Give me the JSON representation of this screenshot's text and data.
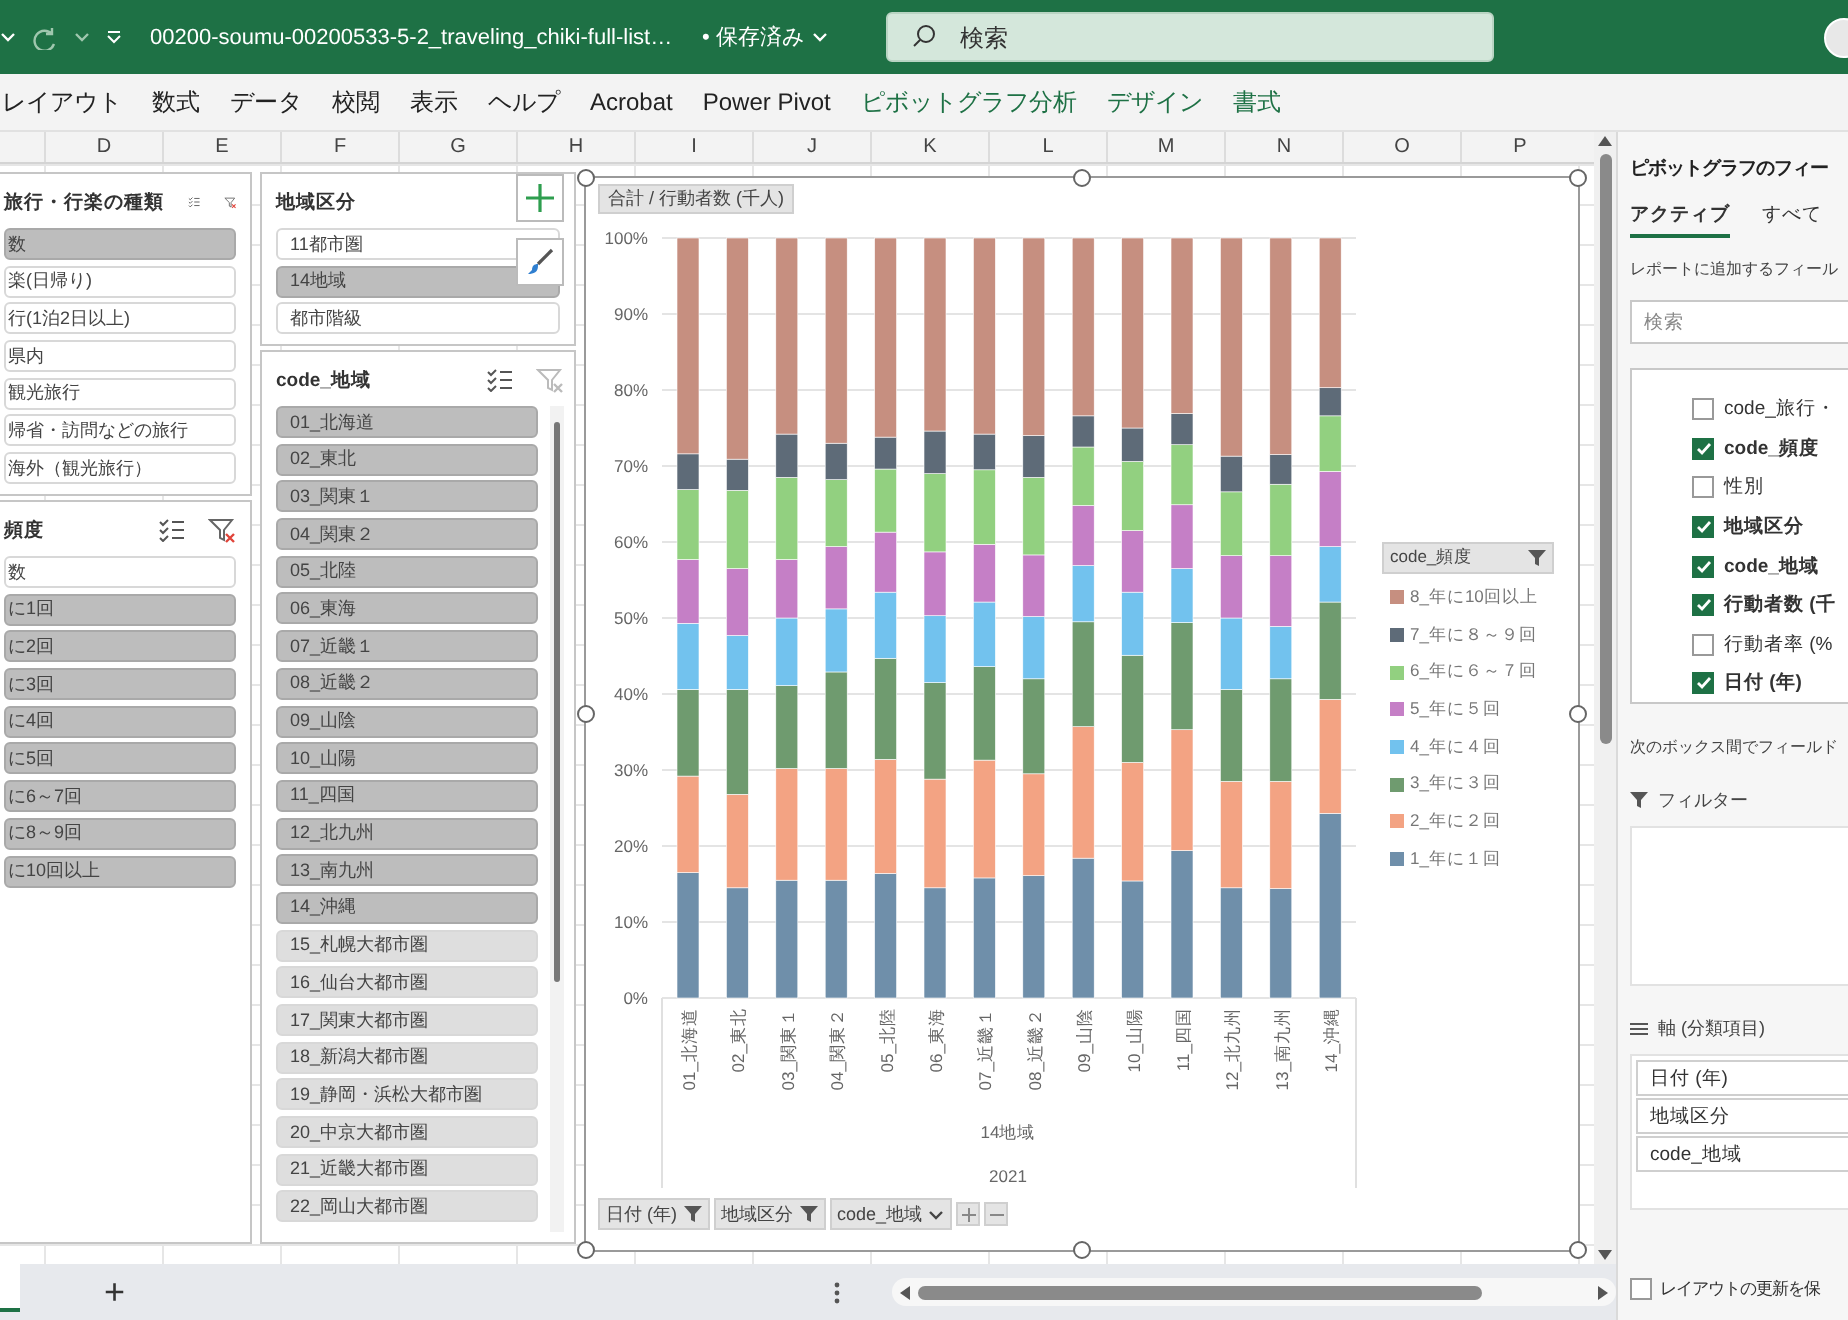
{
  "title_bar": {
    "file_name": "00200-soumu-00200533-5-2_traveling_chiki-full-list…",
    "save_status": "• 保存済み",
    "search": {
      "placeholder": "検索"
    }
  },
  "ribbon_tabs": [
    {
      "label": "レイアウト",
      "kind": "normal"
    },
    {
      "label": "数式",
      "kind": "normal"
    },
    {
      "label": "データ",
      "kind": "normal"
    },
    {
      "label": "校閲",
      "kind": "normal"
    },
    {
      "label": "表示",
      "kind": "normal"
    },
    {
      "label": "ヘルプ",
      "kind": "normal"
    },
    {
      "label": "Acrobat",
      "kind": "normal"
    },
    {
      "label": "Power Pivot",
      "kind": "normal"
    },
    {
      "label": "ピボットグラフ分析",
      "kind": "contextual"
    },
    {
      "label": "デザイン",
      "kind": "contextual"
    },
    {
      "label": "書式",
      "kind": "contextual"
    }
  ],
  "column_headers": [
    "D",
    "E",
    "F",
    "G",
    "H",
    "I",
    "J",
    "K",
    "L",
    "M",
    "N",
    "O",
    "P"
  ],
  "slicers": [
    {
      "title": "旅行・行楽の種類",
      "kind": "plain",
      "filtered": true,
      "items": [
        {
          "label": "数",
          "selected": true
        },
        {
          "label": "楽(日帰り)",
          "selected": false
        },
        {
          "label": "行(1泊2日以上)",
          "selected": false
        },
        {
          "label": "県内",
          "selected": false
        },
        {
          "label": "観光旅行",
          "selected": false
        },
        {
          "label": "帰省・訪問などの旅行",
          "selected": false
        },
        {
          "label": "海外（観光旅行）",
          "selected": false
        }
      ]
    },
    {
      "title": "頻度",
      "kind": "plain",
      "filtered": true,
      "items": [
        {
          "label": "数",
          "selected": false
        },
        {
          "label": "に1回",
          "selected": true
        },
        {
          "label": "に2回",
          "selected": true
        },
        {
          "label": "に3回",
          "selected": true
        },
        {
          "label": "に4回",
          "selected": true
        },
        {
          "label": "に5回",
          "selected": true
        },
        {
          "label": "に6～7回",
          "selected": true
        },
        {
          "label": "に8～9回",
          "selected": true
        },
        {
          "label": "に10回以上",
          "selected": true
        }
      ]
    },
    {
      "title": "地域区分",
      "kind": "plain",
      "items": [
        {
          "label": "11都市圏",
          "selected": false
        },
        {
          "label": "14地域",
          "selected": true
        },
        {
          "label": "都市階級",
          "selected": false
        }
      ]
    },
    {
      "title": "code_地域",
      "kind": "scroll",
      "filtered": false,
      "items": [
        {
          "label": "01_北海道",
          "selected": true
        },
        {
          "label": "02_東北",
          "selected": true
        },
        {
          "label": "03_関東１",
          "selected": true
        },
        {
          "label": "04_関東２",
          "selected": true
        },
        {
          "label": "05_北陸",
          "selected": true
        },
        {
          "label": "06_東海",
          "selected": true
        },
        {
          "label": "07_近畿１",
          "selected": true
        },
        {
          "label": "08_近畿２",
          "selected": true
        },
        {
          "label": "09_山陰",
          "selected": true
        },
        {
          "label": "10_山陽",
          "selected": true
        },
        {
          "label": "11_四国",
          "selected": true
        },
        {
          "label": "12_北九州",
          "selected": true
        },
        {
          "label": "13_南九州",
          "selected": true
        },
        {
          "label": "14_沖縄",
          "selected": true
        },
        {
          "label": "15_札幌大都市圏",
          "selected": false
        },
        {
          "label": "16_仙台大都市圏",
          "selected": false
        },
        {
          "label": "17_関東大都市圏",
          "selected": false
        },
        {
          "label": "18_新潟大都市圏",
          "selected": false
        },
        {
          "label": "19_静岡・浜松大都市圏",
          "selected": false
        },
        {
          "label": "20_中京大都市圏",
          "selected": false
        },
        {
          "label": "21_近畿大都市圏",
          "selected": false
        },
        {
          "label": "22_岡山大都市圏",
          "selected": false
        }
      ]
    }
  ],
  "chart": {
    "value_field": "合計 / 行動者数 (千人)",
    "legend_title": "code_頻度",
    "axis_groups": [
      "14地域",
      "2021"
    ],
    "field_buttons": [
      {
        "label": "日付 (年)",
        "filtered": true
      },
      {
        "label": "地域区分",
        "filtered": true
      },
      {
        "label": "code_地域",
        "filtered": false
      }
    ],
    "chart_data": {
      "type": "bar",
      "stacked": true,
      "orientation": "vertical",
      "grid": true,
      "legend": "right",
      "categories": [
        "01_北海道",
        "02_東北",
        "03_関東１",
        "04_関東２",
        "05_北陸",
        "06_東海",
        "07_近畿１",
        "08_近畿２",
        "09_山陰",
        "10_山陽",
        "11_四国",
        "12_北九州",
        "13_南九州",
        "14_沖縄"
      ],
      "ylim": [
        0,
        100
      ],
      "yticks": [
        {
          "value": 0,
          "label": "0%"
        },
        {
          "value": 10,
          "label": "10%"
        },
        {
          "value": 20,
          "label": "20%"
        },
        {
          "value": 30,
          "label": "30%"
        },
        {
          "value": 40,
          "label": "40%"
        },
        {
          "value": 50,
          "label": "50%"
        },
        {
          "value": 60,
          "label": "60%"
        },
        {
          "value": 70,
          "label": "70%"
        },
        {
          "value": 80,
          "label": "80%"
        },
        {
          "value": 90,
          "label": "90%"
        },
        {
          "value": 100,
          "label": "100%"
        }
      ],
      "series": [
        {
          "name": "1_年に１回",
          "color": "#6f8faa",
          "values": [
            16.5,
            14.5,
            15.5,
            15.5,
            16.4,
            14.5,
            15.8,
            16.1,
            18.4,
            15.4,
            19.4,
            14.5,
            14.4,
            24.3
          ]
        },
        {
          "name": "2_年に２回",
          "color": "#f3a383",
          "values": [
            12.7,
            12.3,
            14.7,
            14.7,
            15.0,
            14.3,
            15.5,
            13.4,
            17.3,
            15.6,
            15.9,
            14.0,
            14.1,
            15.0
          ]
        },
        {
          "name": "3_年に３回",
          "color": "#6f9b6f",
          "values": [
            11.4,
            13.8,
            10.9,
            12.7,
            13.3,
            12.7,
            12.3,
            12.5,
            13.8,
            14.1,
            14.1,
            12.1,
            13.5,
            12.8
          ]
        },
        {
          "name": "4_年に４回",
          "color": "#72c2ee",
          "values": [
            8.7,
            7.1,
            8.9,
            8.3,
            8.7,
            8.8,
            8.5,
            8.2,
            7.4,
            8.3,
            7.1,
            9.4,
            6.9,
            7.3
          ]
        },
        {
          "name": "5_年に５回",
          "color": "#c57fc6",
          "values": [
            8.4,
            8.8,
            7.7,
            8.2,
            7.9,
            8.4,
            7.6,
            8.1,
            7.9,
            8.1,
            8.4,
            8.2,
            9.3,
            9.9
          ]
        },
        {
          "name": "6_年に６～７回",
          "color": "#92d080",
          "values": [
            9.2,
            10.3,
            10.8,
            8.8,
            8.3,
            10.3,
            9.8,
            10.2,
            7.7,
            9.1,
            7.9,
            8.4,
            9.4,
            7.3
          ]
        },
        {
          "name": "7_年に８～９回",
          "color": "#5e6b78",
          "values": [
            4.7,
            4.1,
            5.7,
            4.8,
            4.2,
            5.6,
            4.7,
            5.5,
            4.1,
            4.4,
            4.1,
            4.7,
            3.9,
            3.7
          ]
        },
        {
          "name": "8_年に10回以上",
          "color": "#c68f80",
          "values": [
            28.4,
            29.1,
            25.8,
            27.0,
            26.2,
            25.4,
            25.8,
            26.0,
            23.4,
            25.0,
            23.1,
            28.7,
            28.5,
            19.7
          ]
        }
      ]
    }
  },
  "sheet_tabs": {
    "add_sheet": "+"
  },
  "panel": {
    "title": "ピボットグラフのフィー",
    "tabs": [
      {
        "label": "アクティブ",
        "selected": true
      },
      {
        "label": "すべて",
        "selected": false
      }
    ],
    "prompt": "レポートに追加するフィール",
    "search": {
      "placeholder": "検索"
    },
    "fields": [
      {
        "label": "code_旅行・",
        "checked": false
      },
      {
        "label": "code_頻度",
        "checked": true
      },
      {
        "label": "性別",
        "checked": false
      },
      {
        "label": "地域区分",
        "checked": true
      },
      {
        "label": "code_地域",
        "checked": true
      },
      {
        "label": "行動者数 (千",
        "checked": true
      },
      {
        "label": "行動者率 (%",
        "checked": false
      },
      {
        "label": "日付 (年)",
        "checked": true
      }
    ],
    "drag_prompt": "次のボックス間でフィールド",
    "filter_area": {
      "title": "フィルター"
    },
    "axis_area": {
      "title": "軸 (分類項目)",
      "items": [
        "日付 (年)",
        "地域区分",
        "code_地域"
      ]
    },
    "defer_update": {
      "label": "レイアウトの更新を保",
      "checked": false
    }
  }
}
